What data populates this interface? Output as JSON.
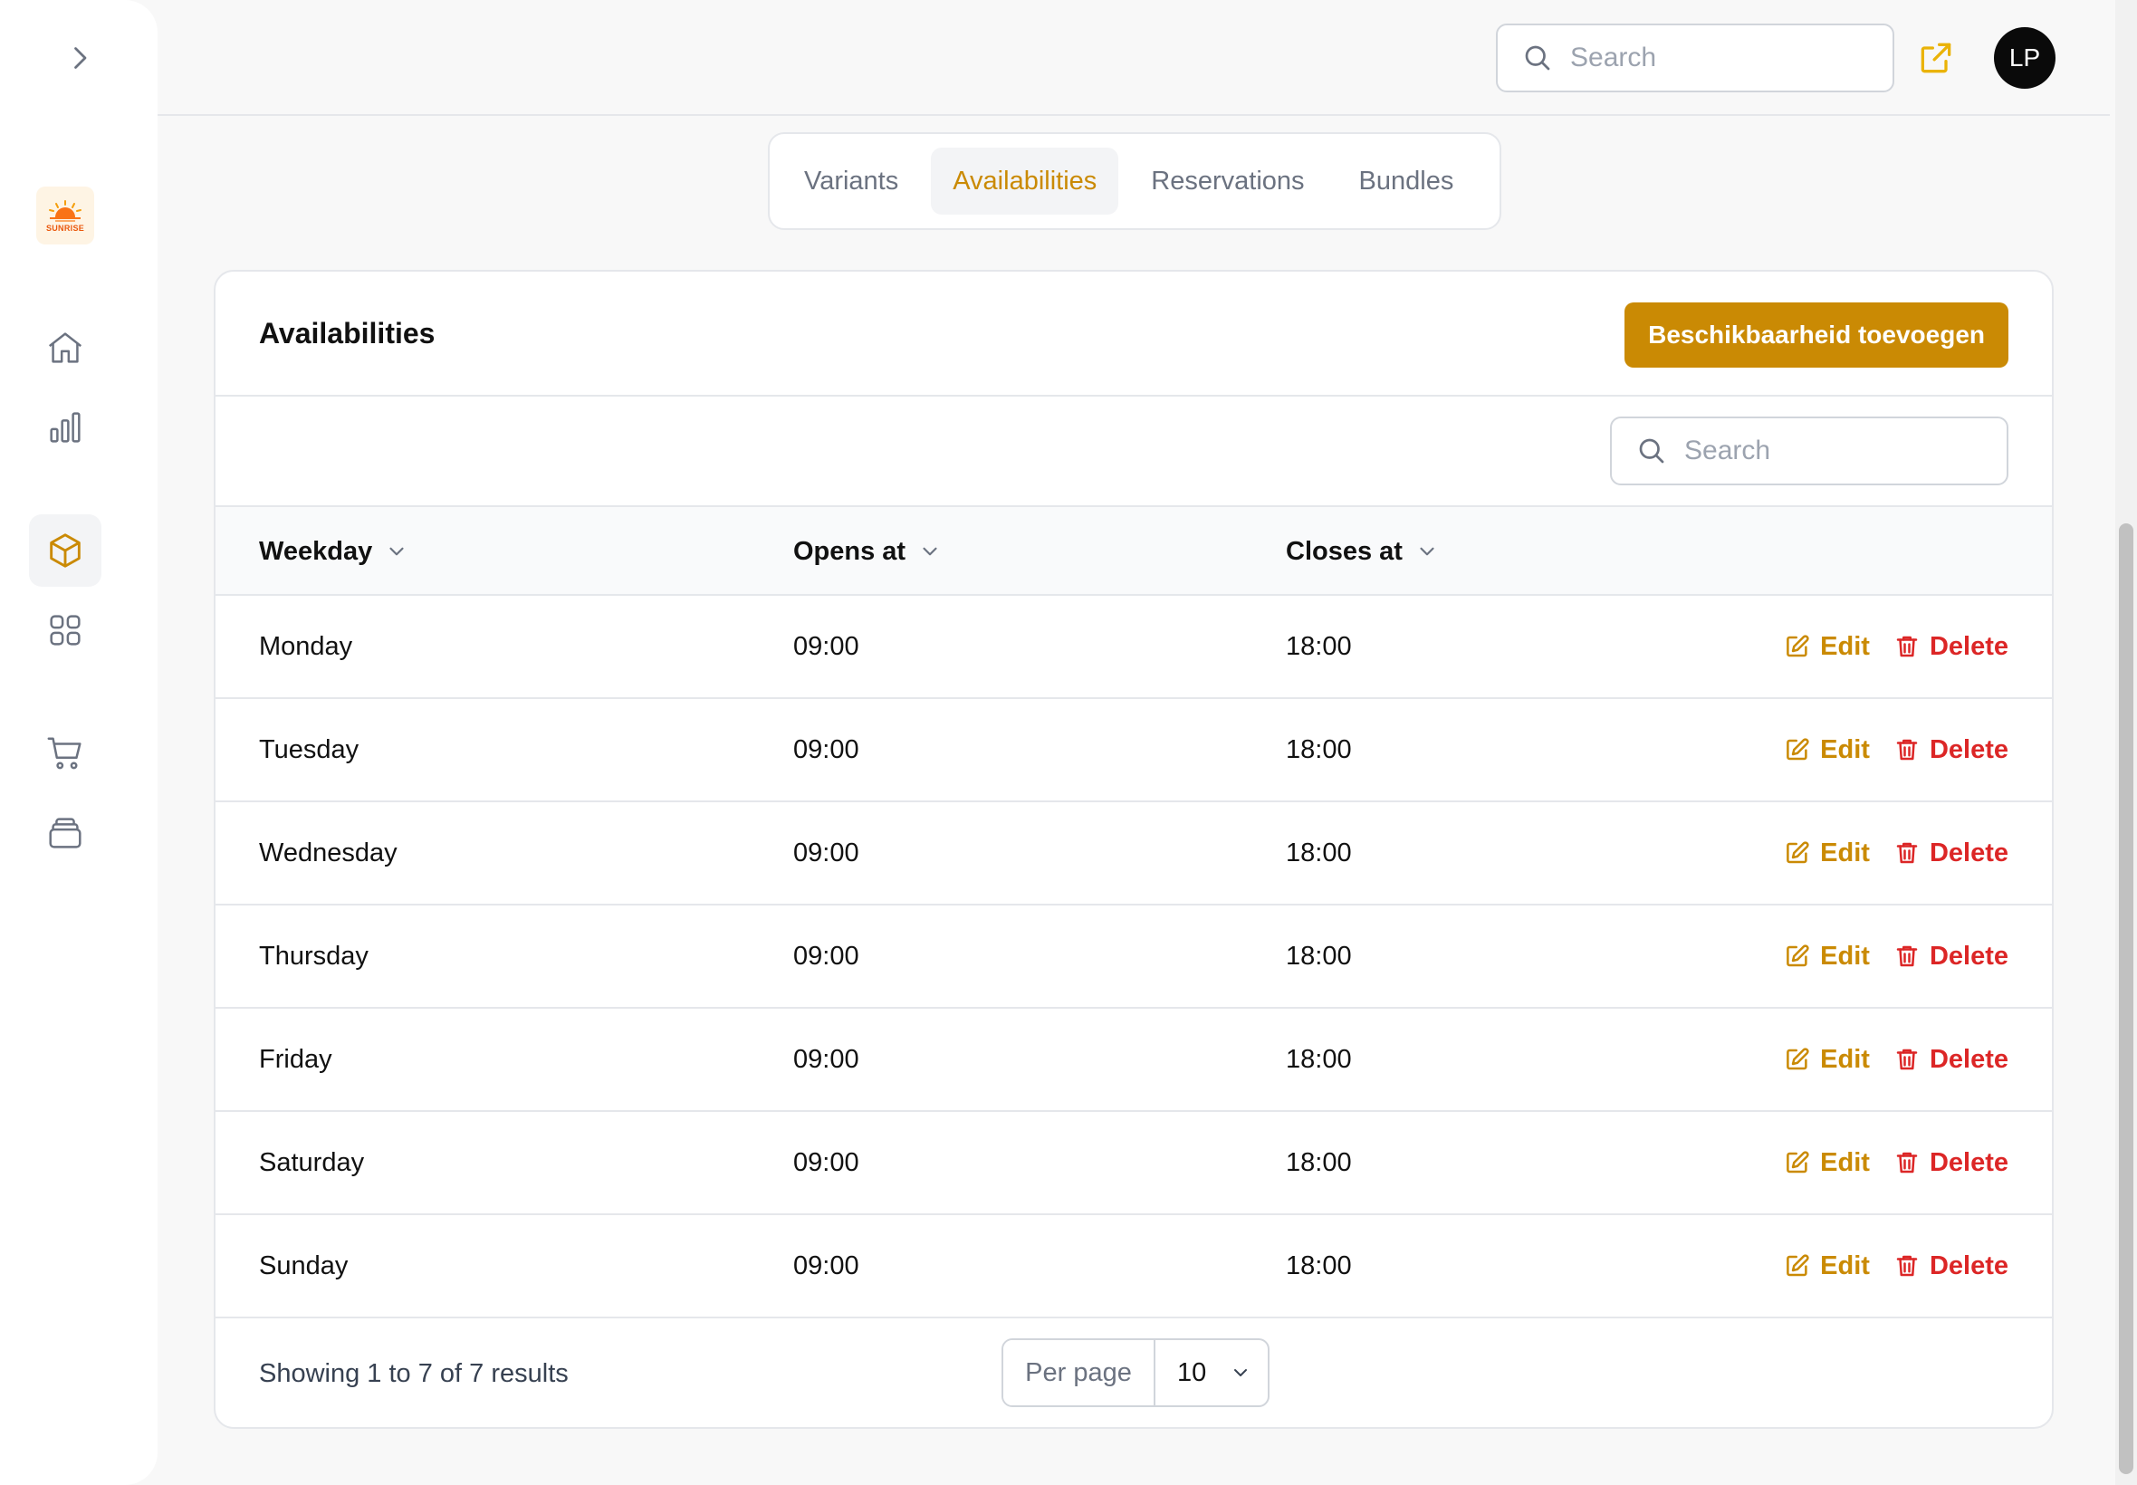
{
  "header": {
    "search_placeholder": "Search",
    "avatar_initials": "LP"
  },
  "logo": {
    "text": "SUNRISE"
  },
  "sidebar": {
    "items": [
      {
        "icon": "home-icon"
      },
      {
        "icon": "chart-icon"
      },
      {
        "icon": "cube-icon",
        "active": true
      },
      {
        "icon": "grid-icon"
      },
      {
        "icon": "cart-icon"
      },
      {
        "icon": "stack-icon"
      }
    ]
  },
  "tabs": [
    {
      "label": "Variants"
    },
    {
      "label": "Availabilities",
      "active": true
    },
    {
      "label": "Reservations"
    },
    {
      "label": "Bundles"
    }
  ],
  "card": {
    "title": "Availabilities",
    "add_button": "Beschikbaarheid toevoegen",
    "search_placeholder": "Search"
  },
  "table": {
    "columns": [
      "Weekday",
      "Opens at",
      "Closes at"
    ],
    "edit_label": "Edit",
    "delete_label": "Delete",
    "rows": [
      {
        "weekday": "Monday",
        "opens": "09:00",
        "closes": "18:00"
      },
      {
        "weekday": "Tuesday",
        "opens": "09:00",
        "closes": "18:00"
      },
      {
        "weekday": "Wednesday",
        "opens": "09:00",
        "closes": "18:00"
      },
      {
        "weekday": "Thursday",
        "opens": "09:00",
        "closes": "18:00"
      },
      {
        "weekday": "Friday",
        "opens": "09:00",
        "closes": "18:00"
      },
      {
        "weekday": "Saturday",
        "opens": "09:00",
        "closes": "18:00"
      },
      {
        "weekday": "Sunday",
        "opens": "09:00",
        "closes": "18:00"
      }
    ]
  },
  "pagination": {
    "summary": "Showing 1 to 7 of 7 results",
    "per_page_label": "Per page",
    "per_page_value": "10"
  },
  "colors": {
    "accent": "#ca8a04",
    "danger": "#dc2626"
  }
}
